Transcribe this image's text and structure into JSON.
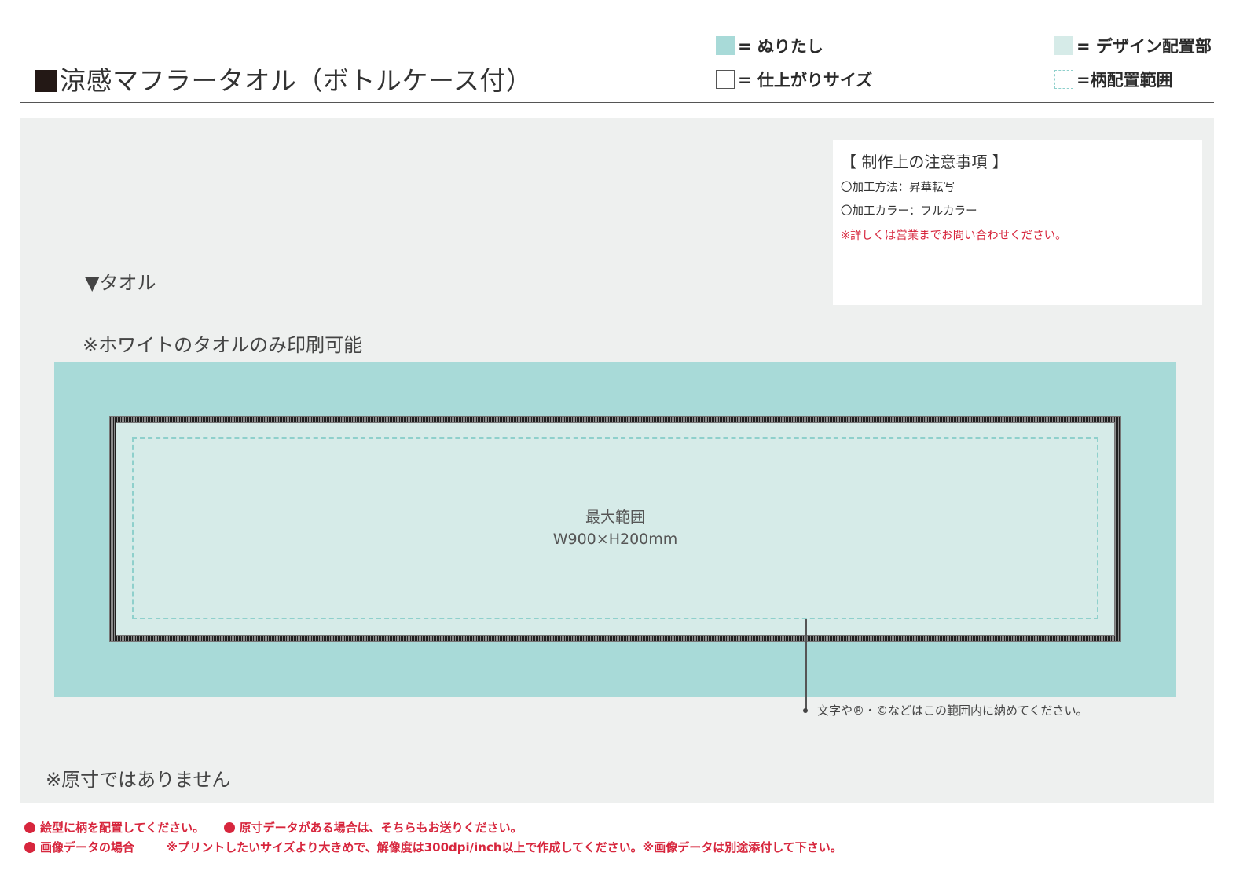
{
  "header": {
    "title": "涼感マフラータオル（ボトルケース付）",
    "legend": [
      {
        "label": "= ぬりたし",
        "swatch": "bleed",
        "color": "#a8dad8"
      },
      {
        "label": "= 仕上がりサイズ",
        "swatch": "finish",
        "color": "#ffffff"
      },
      {
        "label": "= デザイン配置部",
        "swatch": "design",
        "color": "#d6ebe8"
      },
      {
        "label": "=柄配置範囲",
        "swatch": "pattern",
        "color": "#8fd0cc"
      }
    ]
  },
  "notes": {
    "title": "【 制作上の注意事項 】",
    "items": [
      "〇加工方法：昇華転写",
      "〇加工カラー：フルカラー"
    ],
    "warning": "※詳しくは営業までお問い合わせください。"
  },
  "section": {
    "label": "▼タオル",
    "print_note": "※ホワイトのタオルのみ印刷可能"
  },
  "drawing": {
    "area_title": "最大範囲",
    "area_size": "W900×H200mm",
    "leader_text": "文字や®・©などはこの範囲内に納めてください。"
  },
  "not_actual_size": "※原寸ではありません",
  "footer": {
    "line1_a": "絵型に柄を配置してください。",
    "line1_b": "原寸データがある場合は、そちらもお送りください。",
    "line2_a": "画像データの場合",
    "line2_b": "※プリントしたいサイズより大きめで、解像度は300dpi/inch以上で作成してください。※画像データは別途添付して下さい。"
  },
  "colors": {
    "bleed": "#a8dad8",
    "design": "#d6ebe8",
    "pattern_border": "#8fd0cc",
    "warning": "#d7263d",
    "canvas": "#eef0ef"
  }
}
